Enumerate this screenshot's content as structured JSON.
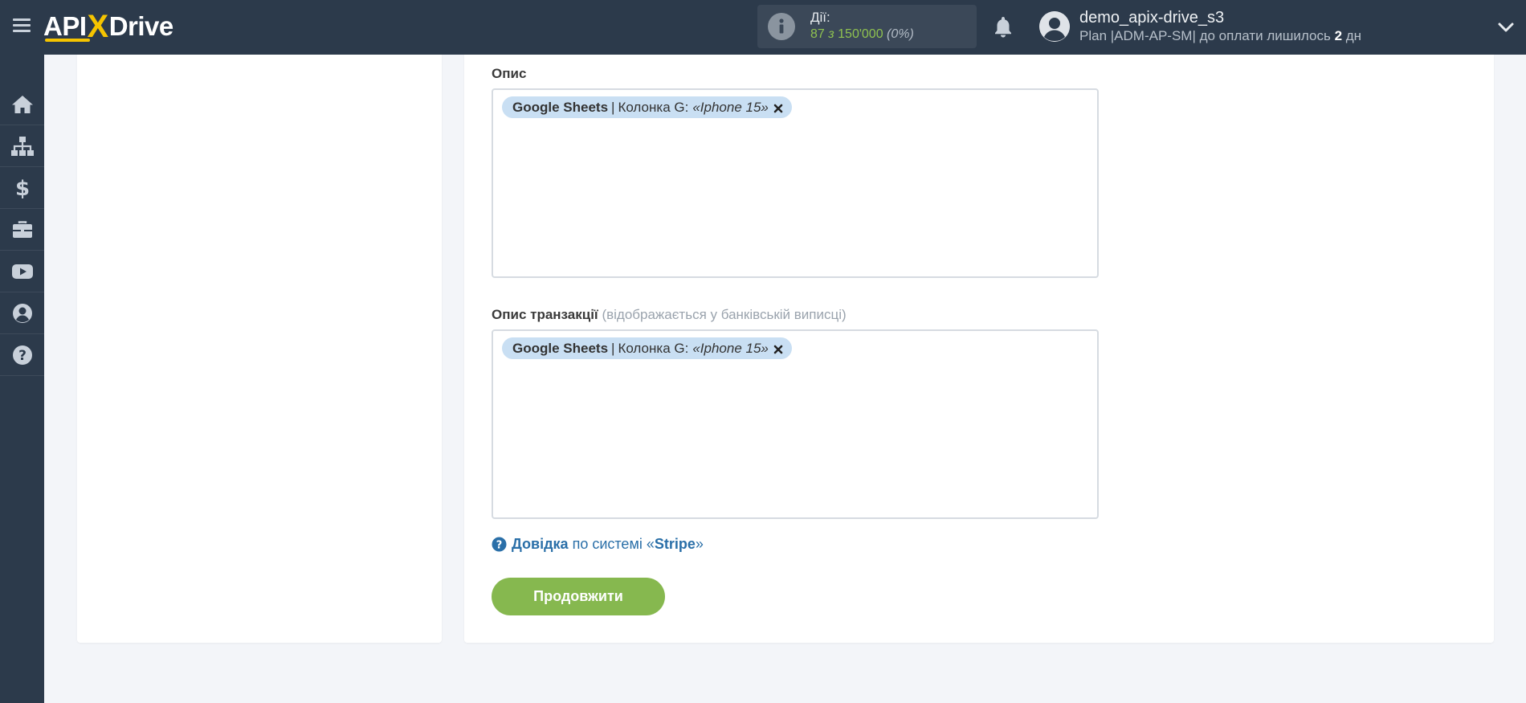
{
  "header": {
    "logo": {
      "part1": "API",
      "x": "X",
      "part2": "Drive"
    },
    "actions": {
      "title": "Дії:",
      "used": "87",
      "of": "з",
      "limit": "150'000",
      "percent": "(0%)"
    },
    "user": {
      "name": "demo_apix-drive_s3",
      "plan_prefix": "Plan |ADM-AP-SM| до оплати лишилось",
      "days": "2",
      "days_suffix": "дн"
    }
  },
  "sidebar": {
    "items": [
      {
        "icon": "home-icon"
      },
      {
        "icon": "sitemap-icon"
      },
      {
        "icon": "dollar-icon"
      },
      {
        "icon": "briefcase-icon"
      },
      {
        "icon": "youtube-icon"
      },
      {
        "icon": "user-circle-icon"
      },
      {
        "icon": "question-circle-icon"
      }
    ]
  },
  "form": {
    "description": {
      "label": "Опис",
      "chip": {
        "source": "Google Sheets",
        "separator": "|",
        "column": "Колонка G:",
        "value": "«Iphone 15»"
      }
    },
    "transaction_description": {
      "label": "Опис транзакції",
      "hint": "(відображається у банківській виписці)",
      "chip": {
        "source": "Google Sheets",
        "separator": "|",
        "column": "Колонка G:",
        "value": "«Iphone 15»"
      }
    },
    "help": {
      "link_text": "Довідка",
      "middle": "по системі «",
      "system": "Stripe",
      "end": "»"
    },
    "continue_label": "Продовжити"
  },
  "colors": {
    "topbar": "#2c3a4b",
    "accent_green": "#86b84f",
    "chip_bg": "#c9dff3",
    "link_blue": "#2a6fa8",
    "logo_yellow": "#f5c400"
  }
}
